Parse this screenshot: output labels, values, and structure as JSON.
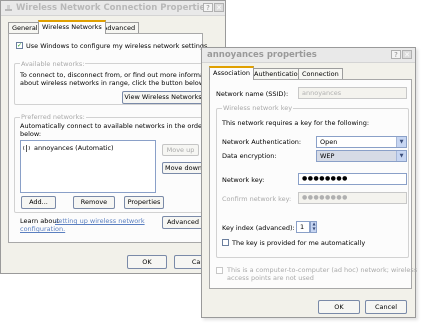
{
  "back_dialog": {
    "title": "Wireless Network Connection Properties",
    "tabs": [
      "General",
      "Wireless Networks",
      "Advanced"
    ],
    "use_windows_label": "Use Windows to configure my wireless network settings",
    "available_group_label": "Available networks:",
    "available_desc": [
      "To connect to, disconnect from, or find out more information",
      "about wireless networks in range, click the button below."
    ],
    "view_button": "View Wireless Networks",
    "preferred_group_label": "Preferred networks:",
    "preferred_desc": [
      "Automatically connect to available networks in the order listed",
      "below:"
    ],
    "preferred_item": "annoyances (Automatic)",
    "move_up": "Move up",
    "move_down": "Move down",
    "add": "Add...",
    "remove": "Remove",
    "properties": "Properties",
    "learn_prefix": "Learn about ",
    "learn_link_1": "setting up wireless network",
    "learn_link_2": "configuration.",
    "advanced": "Advanced",
    "ok": "OK",
    "cancel": "Canc"
  },
  "front_dialog": {
    "title": "annoyances properties",
    "tabs": [
      "Association",
      "Authentication",
      "Connection"
    ],
    "ssid_label": "Network name (SSID):",
    "ssid_value": "annoyances",
    "key_group_label": "Wireless network key",
    "key_desc": "This network requires a key for the following:",
    "auth_label": "Network Authentication:",
    "auth_value": "Open",
    "enc_label": "Data encryption:",
    "enc_value": "WEP",
    "key_label": "Network key:",
    "key_value": "●●●●●●●●",
    "confirm_label": "Confirm network key:",
    "confirm_value": "●●●●●●●●",
    "index_label": "Key index (advanced):",
    "index_value": "1",
    "auto_key_label": "The key is provided for me automatically",
    "adhoc_label": [
      "This is a computer-to-computer (ad hoc) network; wireless",
      "access points are not used"
    ],
    "ok": "OK",
    "cancel": "Cancel"
  },
  "icons": {
    "help": "help-icon",
    "close": "close-icon",
    "network": "wireless-network-icon"
  },
  "colors": {
    "active_tab_accent": "#e0a000",
    "link": "#5a7fc0",
    "checkmark": "#1a9a1a"
  }
}
